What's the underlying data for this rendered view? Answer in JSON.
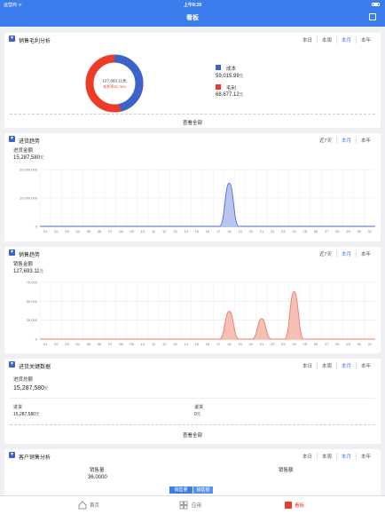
{
  "status": {
    "carrier": "运营商 ᯤ",
    "time": "上午8:28"
  },
  "nav": {
    "title": "看板"
  },
  "colors": {
    "primary": "#3b7ded",
    "cost": "#3b63c9",
    "profit": "#ee3b27",
    "sales_fill": "#f6bfb4",
    "sales_line": "#e8735c",
    "purchase_fill": "#b9c5f0"
  },
  "profit_card": {
    "title": "销售毛利分析",
    "tabs": [
      "本日",
      "本周",
      "本月",
      "本年"
    ],
    "active_tab": "本月",
    "center_value": "127,693.11元",
    "center_rate": "毛利率53.78%",
    "cost_label": "成本",
    "cost_value": "59,015.99",
    "cost_unit": "元",
    "profit_label": "毛利",
    "profit_value": "68,677.12",
    "profit_unit": "元",
    "view_all": "查看全部"
  },
  "purchase_card": {
    "title": "进货趋势",
    "tabs": [
      "近7天",
      "本月",
      "本年"
    ],
    "active_tab": "本月",
    "metric_label": "进货金额",
    "metric_value": "15,287,580",
    "metric_unit": "元"
  },
  "sales_card": {
    "title": "销售趋势",
    "tabs": [
      "近7天",
      "本月",
      "本年"
    ],
    "active_tab": "本月",
    "metric_label": "销售金额",
    "metric_value": "127,693.11",
    "metric_unit": "元"
  },
  "keydata_card": {
    "title": "进货关键数据",
    "tabs": [
      "本日",
      "本周",
      "本月",
      "本年"
    ],
    "active_tab": "本月",
    "total_label": "进货总额",
    "total_value": "15,287,580",
    "total_unit": "元",
    "purchase_label": "进货",
    "purchase_value": "15,287,580",
    "purchase_unit": "元",
    "return_label": "退货",
    "return_value": "0",
    "return_unit": "元",
    "view_all": "查看全部"
  },
  "customer_card": {
    "title": "客户销售分析",
    "tabs": [
      "本日",
      "本周",
      "本月",
      "本年"
    ],
    "active_tab": "本月",
    "qty_label": "销售量",
    "qty_value": "36.0000",
    "amount_label": "销售额",
    "seg_qty": "销售量",
    "seg_amount": "销售额"
  },
  "tabbar": {
    "home": "首页",
    "apps": "应用",
    "board": "看板"
  },
  "chart_data": [
    {
      "type": "pie",
      "categories": [
        "成本",
        "毛利"
      ],
      "values": [
        59015.99,
        68677.12
      ]
    },
    {
      "type": "area",
      "x": [
        "01",
        "02",
        "03",
        "04",
        "05",
        "06",
        "07",
        "08",
        "09",
        "10",
        "11",
        "12",
        "13",
        "14",
        "15",
        "16",
        "17",
        "18",
        "19",
        "20",
        "21",
        "22",
        "23",
        "24",
        "25",
        "26",
        "27",
        "28",
        "29",
        "30",
        "31"
      ],
      "values": [
        0,
        0,
        0,
        0,
        0,
        0,
        0,
        0,
        0,
        0,
        0,
        0,
        0,
        0,
        0,
        0,
        0,
        15287580,
        0,
        0,
        0,
        0,
        0,
        0,
        0,
        0,
        0,
        0,
        0,
        0,
        0
      ],
      "yticks": [
        "0",
        "10,000,000",
        "20,000,000"
      ],
      "ylim": [
        0,
        20000000
      ],
      "grid": true
    },
    {
      "type": "area",
      "x": [
        "01",
        "02",
        "03",
        "04",
        "05",
        "06",
        "07",
        "08",
        "09",
        "10",
        "11",
        "12",
        "13",
        "14",
        "15",
        "16",
        "17",
        "18",
        "19",
        "20",
        "21",
        "22",
        "23",
        "24",
        "25",
        "26",
        "27",
        "28",
        "29",
        "30",
        "31"
      ],
      "values": [
        0,
        0,
        0,
        0,
        0,
        0,
        0,
        0,
        0,
        0,
        0,
        0,
        0,
        0,
        0,
        0,
        0,
        37000,
        0,
        0,
        27000,
        0,
        0,
        63000,
        0,
        0,
        0,
        0,
        0,
        0,
        0
      ],
      "yticks": [
        "0",
        "25,000",
        "50,000",
        "75,000"
      ],
      "ylim": [
        0,
        75000
      ],
      "grid": true
    }
  ]
}
